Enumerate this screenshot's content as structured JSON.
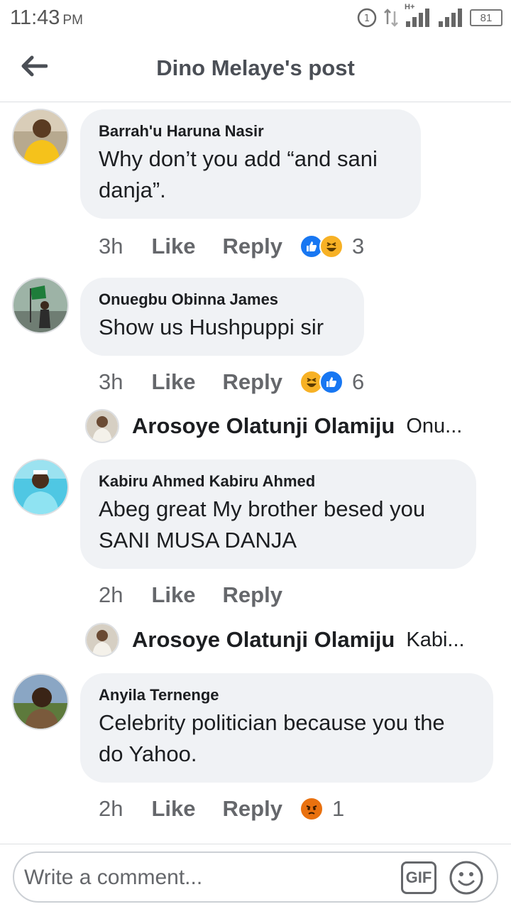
{
  "status_bar": {
    "time": "11:43",
    "ampm": "PM",
    "network_label": "H+",
    "battery": "81"
  },
  "header": {
    "title": "Dino Melaye's post",
    "back_icon": "arrow-left-icon"
  },
  "comments": [
    {
      "author": "Barrah'u Haruna Nasir",
      "text": "Why don’t you add “and sani danja”.",
      "time": "3h",
      "like_label": "Like",
      "reply_label": "Reply",
      "reactions": [
        "like",
        "haha"
      ],
      "reaction_count": "3"
    },
    {
      "author": "Onuegbu Obinna James",
      "text": "Show us Hushpuppi sir",
      "time": "3h",
      "like_label": "Like",
      "reply_label": "Reply",
      "reactions": [
        "haha",
        "like"
      ],
      "reaction_count": "6",
      "reply_preview": {
        "author": "Arosoye Olatunji Olamiju",
        "snippet": "Onu..."
      }
    },
    {
      "author": "Kabiru Ahmed Kabiru Ahmed",
      "text": "Abeg great My brother besed you SANI MUSA DANJA",
      "time": "2h",
      "like_label": "Like",
      "reply_label": "Reply",
      "reply_preview": {
        "author": "Arosoye Olatunji Olamiju",
        "snippet": "Kabi..."
      }
    },
    {
      "author": "Anyila Ternenge",
      "text": "Celebrity politician because you the do Yahoo.",
      "time": "2h",
      "like_label": "Like",
      "reply_label": "Reply",
      "reactions": [
        "angry"
      ],
      "reaction_count": "1"
    }
  ],
  "composer": {
    "placeholder": "Write a comment...",
    "gif_label": "GIF",
    "emoji_icon": "smiley-face-icon"
  },
  "colors": {
    "bubble": "#f0f2f5",
    "like_blue": "#1877f2",
    "haha_yellow": "#f7b125",
    "angry_red": "#e9710f",
    "muted_text": "#65676b"
  }
}
